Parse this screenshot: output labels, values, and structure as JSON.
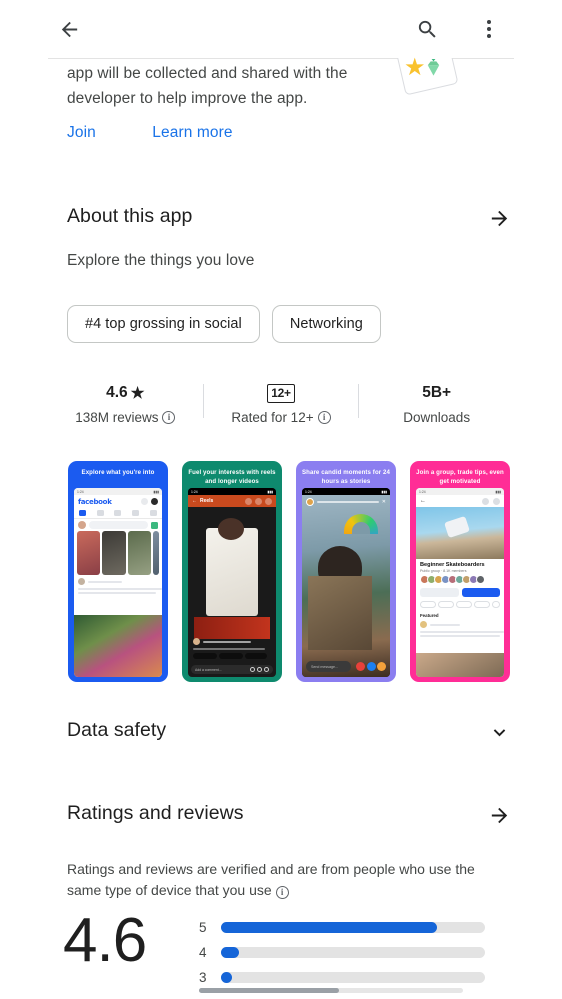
{
  "appbar": {
    "back_icon": "arrow-left-icon",
    "search_icon": "search-icon",
    "overflow_icon": "more-vertical-icon"
  },
  "beta": {
    "text": "app will be collected and shared with the developer to help improve the app.",
    "join_label": "Join",
    "learn_more_label": "Learn more",
    "link_color": "#1a73e8",
    "art_icon": "star-gem-card-illustration"
  },
  "about": {
    "title": "About this app",
    "arrow_icon": "arrow-right-icon",
    "subtitle": "Explore the things you love",
    "chips": [
      {
        "label": "#4 top grossing in social"
      },
      {
        "label": "Networking"
      }
    ]
  },
  "stats": {
    "rating": {
      "value": "4.6",
      "star_icon": "star-filled-icon",
      "caption": "138M reviews",
      "info_icon": "info-icon"
    },
    "age": {
      "badge": "12+",
      "caption": "Rated for 12+",
      "info_icon": "info-icon"
    },
    "downloads": {
      "value": "5B+",
      "caption": "Downloads"
    }
  },
  "screenshots": [
    {
      "caption": "Explore what you're into",
      "bg": "#1b5bf0",
      "brand": "facebook",
      "status_time": "1:24"
    },
    {
      "caption": "Fuel your interests with reels and longer videos",
      "bg": "#0e8a6e",
      "reels_label": "Reels",
      "comment_placeholder": "Add a comment...",
      "status_time": "1:24"
    },
    {
      "caption": "Share candid moments for 24 hours as stories",
      "bg": "#8b7ef0",
      "message_placeholder": "Send message...",
      "status_time": "1:24"
    },
    {
      "caption": "Join a group, trade tips, even get motivated",
      "bg": "#ff2d96",
      "group_name": "Beginner Skateboarders",
      "group_meta": "Public group · 8.1K members",
      "joined_label": "Joined",
      "invite_label": "Invite",
      "featured_label": "Featured",
      "status_time": "1:24"
    }
  ],
  "data_safety": {
    "title": "Data safety",
    "chevron_icon": "chevron-down-icon"
  },
  "ratings": {
    "title": "Ratings and reviews",
    "arrow_icon": "arrow-right-icon",
    "note": "Ratings and reviews are verified and are from people who use the same type of device that you use",
    "info_icon": "info-icon",
    "score": "4.6",
    "bar_color": "#1565d8",
    "track_color": "#e3e3e3",
    "histogram": [
      {
        "star": "5",
        "percent": 82
      },
      {
        "star": "4",
        "percent": 7
      },
      {
        "star": "3",
        "percent": 4
      }
    ]
  },
  "scrollbar": {
    "thumb_percent": 53
  }
}
